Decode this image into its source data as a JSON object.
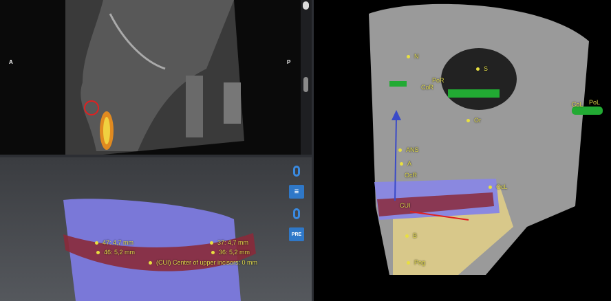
{
  "ct_view": {
    "left_orientation": "A",
    "right_orientation": "P"
  },
  "model_view": {
    "measurements": [
      {
        "label": "47: 4,7 mm"
      },
      {
        "label": "46: 5,2 mm"
      },
      {
        "label": "37: 4,7 mm"
      },
      {
        "label": "36: 5,2 mm"
      },
      {
        "label": "(CUI) Center of upper incisors: 0 mm"
      }
    ],
    "tools": [
      {
        "icon": "rotate-axis-icon"
      },
      {
        "icon": "dental-arch-icon"
      },
      {
        "icon": "rotate-axis-icon"
      },
      {
        "icon": "pre-view-icon",
        "label": "PRE"
      }
    ]
  },
  "skull_view": {
    "landmarks": [
      "N",
      "S",
      "PoR",
      "CoR",
      "Or",
      "CoL",
      "PoL",
      "ANS",
      "A",
      "OcR",
      "OcL",
      "CUI",
      "B",
      "Pog"
    ]
  },
  "colors": {
    "accent": "#2f78c8",
    "label": "#e0d94a",
    "arch": "#7a78d8",
    "plane": "#8a2a3a"
  }
}
